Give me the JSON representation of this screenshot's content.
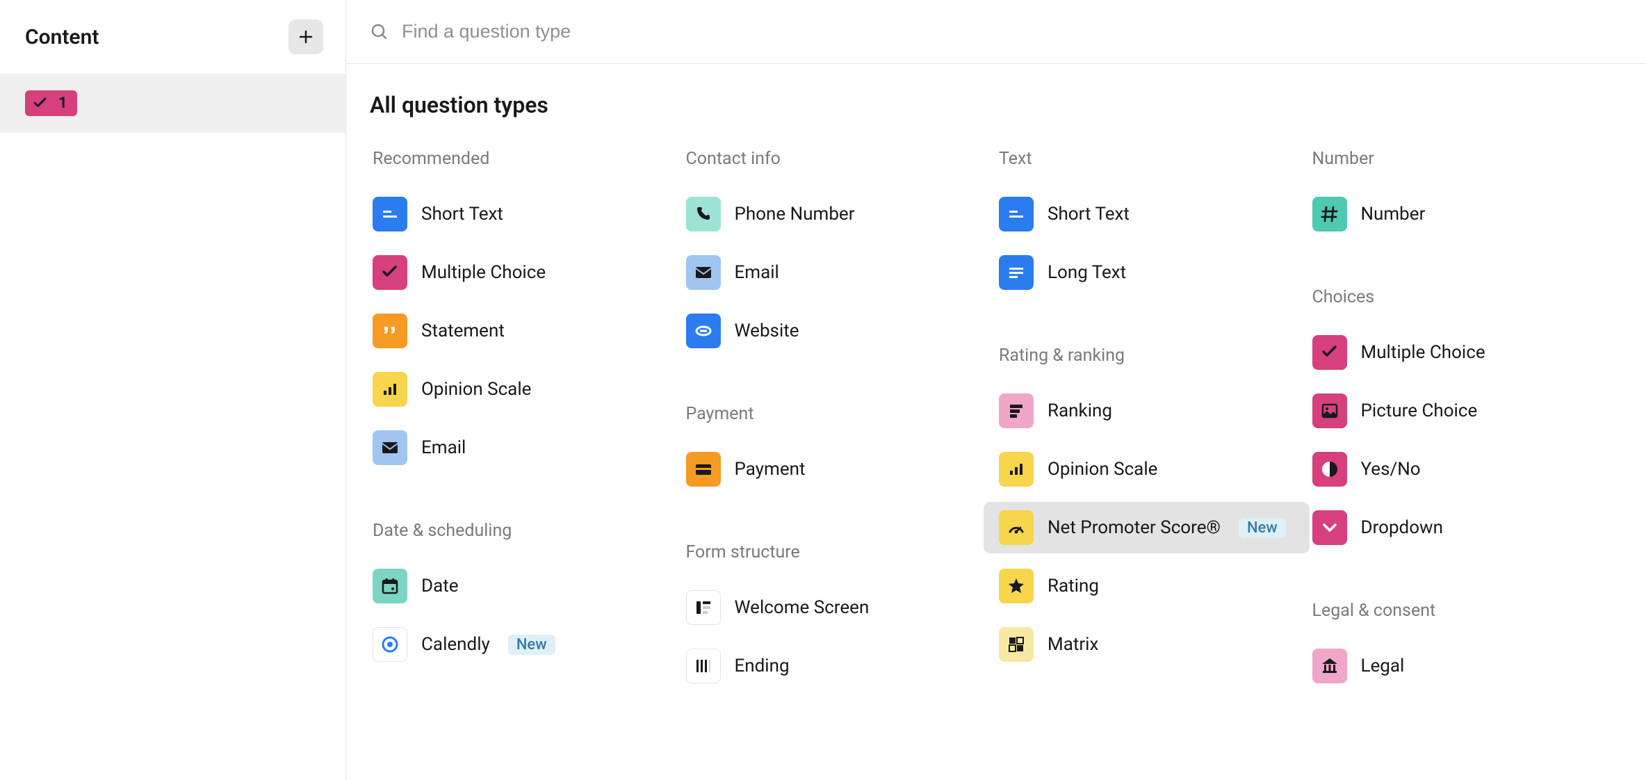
{
  "sidebar": {
    "title": "Content",
    "item_number": "1"
  },
  "search": {
    "placeholder": "Find a question type"
  },
  "section_title": "All question types",
  "badges": {
    "new": "New"
  },
  "groups": {
    "recommended": {
      "title": "Recommended",
      "items": [
        {
          "label": "Short Text",
          "icon": "short-text",
          "color": "#2b7cef"
        },
        {
          "label": "Multiple Choice",
          "icon": "check",
          "color": "#d6407c"
        },
        {
          "label": "Statement",
          "icon": "quote",
          "color": "#f59a23"
        },
        {
          "label": "Opinion Scale",
          "icon": "bars",
          "color": "#f7d54c"
        },
        {
          "label": "Email",
          "icon": "email",
          "color": "#9fc5f0"
        }
      ]
    },
    "date_scheduling": {
      "title": "Date & scheduling",
      "items": [
        {
          "label": "Date",
          "icon": "calendar",
          "color": "#7cd4c2"
        },
        {
          "label": "Calendly",
          "icon": "calendly",
          "color": "white",
          "badge": "new"
        }
      ]
    },
    "contact_info": {
      "title": "Contact info",
      "items": [
        {
          "label": "Phone Number",
          "icon": "phone",
          "color": "#9de3d5"
        },
        {
          "label": "Email",
          "icon": "email",
          "color": "#9fc5f0"
        },
        {
          "label": "Website",
          "icon": "link",
          "color": "#2b7cef"
        }
      ]
    },
    "payment": {
      "title": "Payment",
      "items": [
        {
          "label": "Payment",
          "icon": "card",
          "color": "#f59a23"
        }
      ]
    },
    "form_structure": {
      "title": "Form structure",
      "items": [
        {
          "label": "Welcome Screen",
          "icon": "welcome",
          "color": "white"
        },
        {
          "label": "Ending",
          "icon": "ending",
          "color": "white"
        }
      ]
    },
    "text": {
      "title": "Text",
      "items": [
        {
          "label": "Short Text",
          "icon": "short-text",
          "color": "#2b7cef"
        },
        {
          "label": "Long Text",
          "icon": "long-text",
          "color": "#2b7cef"
        }
      ]
    },
    "rating_ranking": {
      "title": "Rating & ranking",
      "items": [
        {
          "label": "Ranking",
          "icon": "ranking",
          "color": "#f0a6c8"
        },
        {
          "label": "Opinion Scale",
          "icon": "bars",
          "color": "#f7d54c"
        },
        {
          "label": "Net Promoter Score®",
          "icon": "gauge",
          "color": "#f7d54c",
          "badge": "new",
          "hovered": true
        },
        {
          "label": "Rating",
          "icon": "star",
          "color": "#f7d54c"
        },
        {
          "label": "Matrix",
          "icon": "matrix",
          "color": "#f7e9a3"
        }
      ]
    },
    "number": {
      "title": "Number",
      "items": [
        {
          "label": "Number",
          "icon": "hash",
          "color": "#4fc9b0"
        }
      ]
    },
    "choices": {
      "title": "Choices",
      "items": [
        {
          "label": "Multiple Choice",
          "icon": "check",
          "color": "#d6407c"
        },
        {
          "label": "Picture Choice",
          "icon": "image",
          "color": "#d6407c"
        },
        {
          "label": "Yes/No",
          "icon": "yesno",
          "color": "#d6407c"
        },
        {
          "label": "Dropdown",
          "icon": "chevron-down",
          "color": "#d6407c"
        }
      ]
    },
    "legal_consent": {
      "title": "Legal & consent",
      "items": [
        {
          "label": "Legal",
          "icon": "legal",
          "color": "#f0a6c8"
        }
      ]
    }
  }
}
